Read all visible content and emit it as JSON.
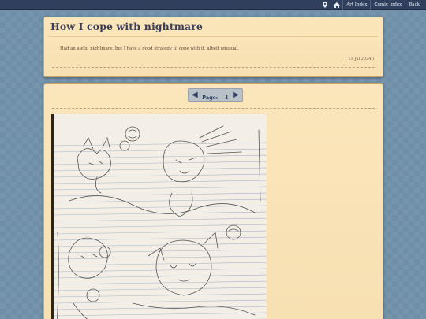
{
  "topbar": {
    "icons": [
      "map-pin-icon",
      "home-icon"
    ],
    "links": [
      "Art Index",
      "Comic Index",
      "Back"
    ]
  },
  "post": {
    "title": "How I cope with nightmare",
    "description": "Had an awful nightmare, but I have a good strategy to cope with it, albeit unusual.",
    "date": "( 13 Jul 2024 )"
  },
  "pager": {
    "prev_icon": "arrow-left-icon",
    "next_icon": "arrow-right-icon",
    "label": "Page:",
    "number": "1"
  },
  "colors": {
    "topbar": "#2f3f5c",
    "panel": "#fbe6bb",
    "background": "#6f8fa8"
  }
}
